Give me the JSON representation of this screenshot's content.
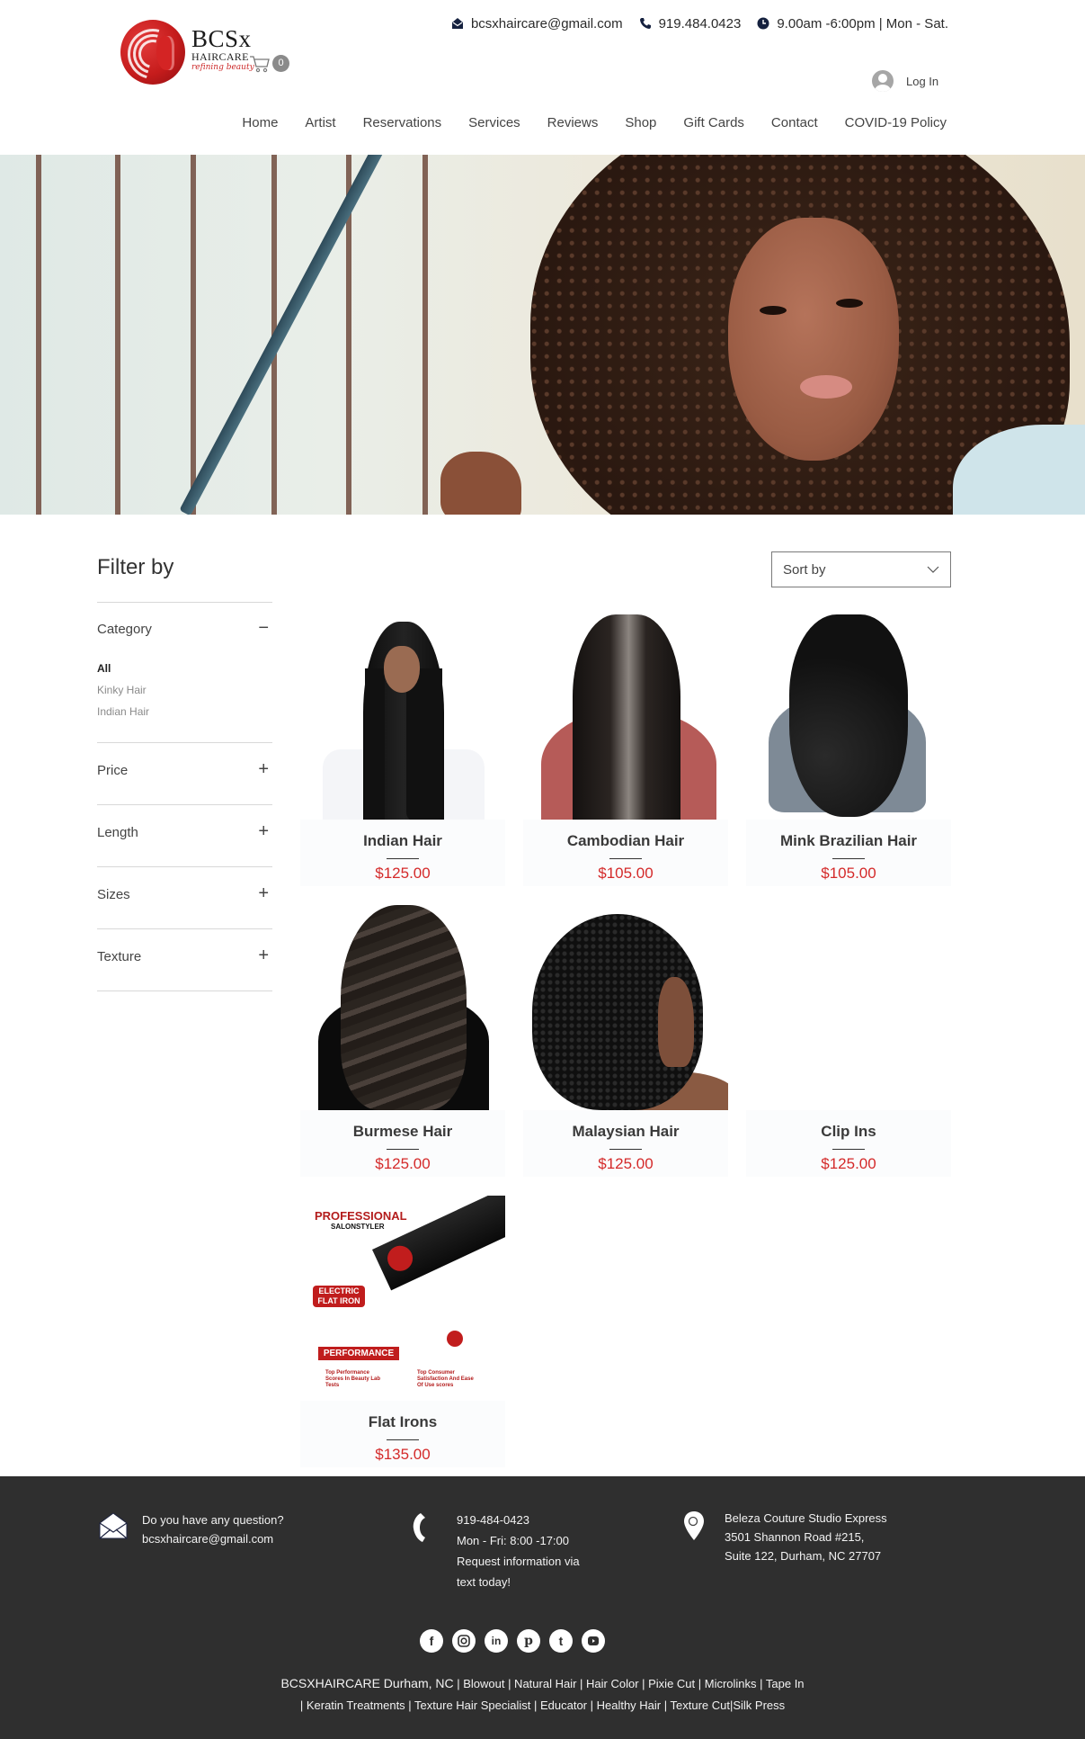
{
  "header": {
    "logo": {
      "title": "BCSx",
      "subtitle": "HAIRCARE",
      "tagline": "refining beauty"
    },
    "cart": {
      "count": "0"
    },
    "contact": {
      "email": "bcsxhaircare@gmail.com",
      "phone": "919.484.0423",
      "hours": "9.00am -6:00pm | Mon - Sat."
    },
    "login_label": "Log In",
    "nav": [
      "Home",
      "Artist",
      "Reservations",
      "Services",
      "Reviews",
      "Shop",
      "Gift Cards",
      "Contact",
      "COVID-19 Policy"
    ]
  },
  "filters": {
    "title": "Filter by",
    "category": {
      "label": "Category",
      "toggle": "−",
      "options": [
        {
          "label": "All",
          "active": true
        },
        {
          "label": "Kinky Hair",
          "active": false
        },
        {
          "label": "Indian Hair",
          "active": false
        }
      ]
    },
    "facets": [
      {
        "label": "Price",
        "toggle": "+"
      },
      {
        "label": "Length",
        "toggle": "+"
      },
      {
        "label": "Sizes",
        "toggle": "+"
      },
      {
        "label": "Texture",
        "toggle": "+"
      }
    ]
  },
  "sort": {
    "label": "Sort by"
  },
  "products": [
    {
      "name": "Indian Hair",
      "price": "$125.00",
      "image": "indian"
    },
    {
      "name": "Cambodian Hair",
      "price": "$105.00",
      "image": "cambodian"
    },
    {
      "name": "Mink Brazilian Hair",
      "price": "$105.00",
      "image": "mink"
    },
    {
      "name": "Burmese Hair",
      "price": "$125.00",
      "image": "burmese"
    },
    {
      "name": "Malaysian Hair",
      "price": "$125.00",
      "image": "malaysian"
    },
    {
      "name": "Clip Ins",
      "price": "$125.00",
      "image": "gift-icon-placeholder"
    },
    {
      "name": "Flat Irons",
      "price": "$135.00",
      "image": "flat-iron"
    }
  ],
  "flat_iron_image_text": {
    "headline": "PROFESSIONAL",
    "sub": "SALONSTYLER",
    "badge": "ELECTRIC FLAT IRON",
    "performance": "PERFORMANCE",
    "check1": "Top Performance Scores In Beauty Lab Tests",
    "check2": "Top Consumer Satisfaction And Ease Of Use scores"
  },
  "footer": {
    "question": {
      "line1": "Do you have any question?",
      "email": "bcsxhaircare@gmail.com"
    },
    "phone": {
      "number": "919-484-0423",
      "hours": "Mon - Fri: 8:00 -17:00",
      "note1": "Request information via",
      "note2": "text today!"
    },
    "address": {
      "name": "Beleza Couture Studio Express",
      "line1": "3501 Shannon Road #215,",
      "line2": "Suite 122, Durham, NC 27707"
    },
    "socials": [
      "facebook",
      "instagram",
      "linkedin",
      "pinterest",
      "tumblr",
      "youtube"
    ],
    "seo_lead": "BCSXHAIRCARE Durham, NC",
    "seo_line1": " | Blowout | Natural Hair | Hair Color | Pixie Cut | Microlinks | Tape In",
    "seo_line2": "| Keratin Treatments | Texture Hair Specialist | Educator | Healthy Hair | Texture Cut|Silk Press"
  },
  "colors": {
    "price": "#d42a2a",
    "footer_bg": "#2f2f2f",
    "brand_red": "#c61c1c",
    "gift_bg": "#404040"
  }
}
